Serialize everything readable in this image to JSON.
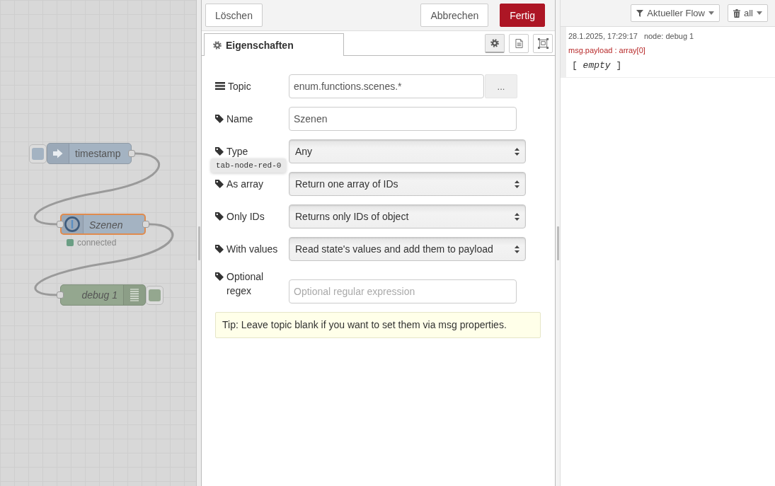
{
  "canvas": {
    "nodes": [
      {
        "kind": "inject",
        "label": "timestamp",
        "selected": false,
        "italic": false
      },
      {
        "kind": "iobroker",
        "label": "Szenen",
        "selected": true,
        "italic": true,
        "status": {
          "text": "connected",
          "color": "#6b9e84"
        }
      },
      {
        "kind": "debug",
        "label": "debug 1",
        "selected": false,
        "italic": true
      }
    ]
  },
  "editor": {
    "buttons_left": [
      {
        "label": "Löschen",
        "primary": false
      }
    ],
    "buttons_right": [
      {
        "label": "Abbrechen",
        "primary": false
      },
      {
        "label": "Fertig",
        "primary": true
      }
    ],
    "tabs": [
      {
        "label": "Eigenschaften",
        "selected": true
      }
    ],
    "view_tabs": [
      {
        "kind": "settings",
        "selected": true
      },
      {
        "kind": "description",
        "selected": false
      },
      {
        "kind": "appearance",
        "selected": false
      }
    ],
    "fields": [
      {
        "kind": "picker",
        "label": "Topic",
        "value": "enum.functions.scenes.*",
        "button": "..."
      },
      {
        "kind": "input",
        "label": "Name",
        "value": "Szenen"
      },
      {
        "kind": "select",
        "label": "Type",
        "value": "Any"
      },
      {
        "kind": "select",
        "label": "As array",
        "value": "Return one array of IDs"
      },
      {
        "kind": "select",
        "label": "Only IDs",
        "value": "Returns only IDs of object"
      },
      {
        "kind": "select",
        "label": "With values",
        "value": "Read state's values and add them to payload"
      },
      {
        "kind": "input",
        "label": "Optional regex",
        "placeholder": "Optional regular expression"
      }
    ],
    "tooltip": "tab-node-red-0",
    "tip": "Tip: Leave topic blank if you want to set them via msg properties."
  },
  "sidebar": {
    "filters": [
      {
        "kind": "filter",
        "label": "Aktueller Flow"
      },
      {
        "kind": "clear",
        "label": "all"
      }
    ],
    "messages": [
      {
        "time": "28.1.2025, 17:29:17",
        "node": "node: debug 1",
        "property": "msg.payload : array[0]",
        "value": "[ *empty* ]"
      }
    ]
  }
}
